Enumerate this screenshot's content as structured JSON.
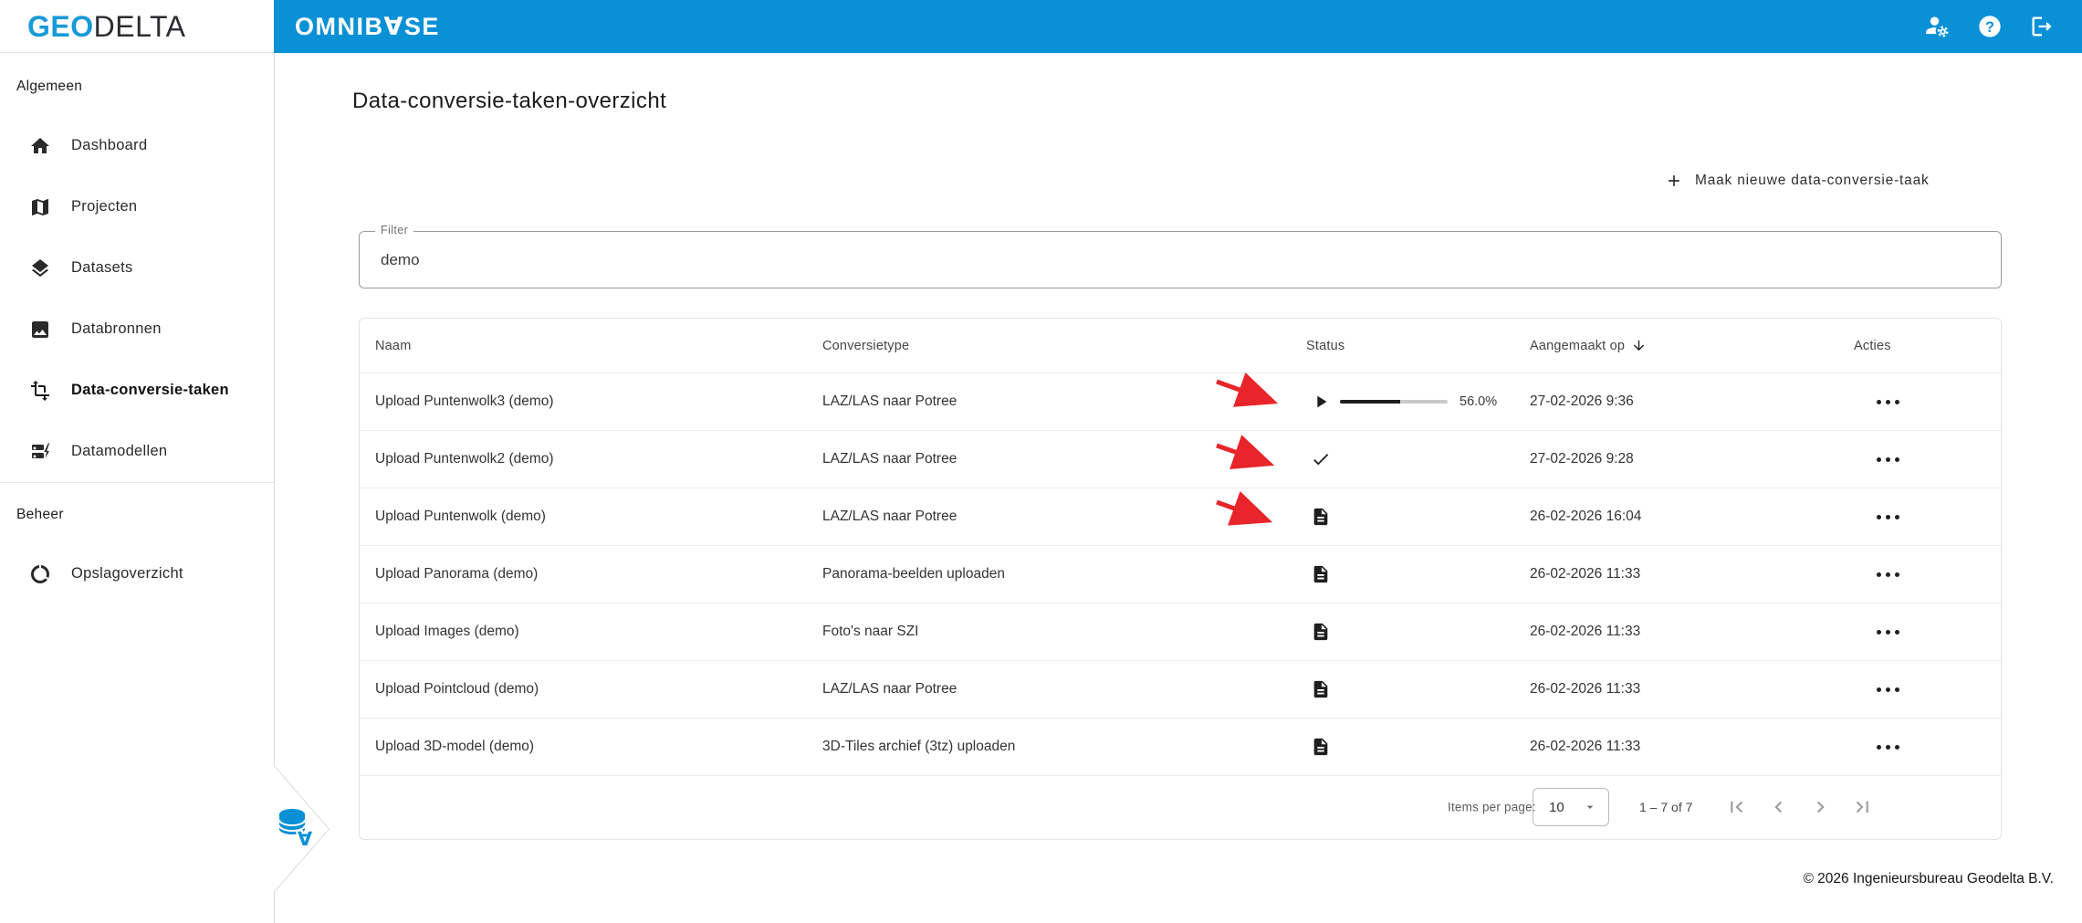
{
  "brand": {
    "logo_part1": "GEO",
    "logo_part2": "DELTA",
    "app_name": "OMNIB∀SE"
  },
  "colors": {
    "header_blue": "#0a90d5",
    "logo_blue": "#189ad8",
    "annotation_red": "#e8252a"
  },
  "sidebar": {
    "sections": [
      {
        "label": "Algemeen",
        "items": [
          {
            "label": "Dashboard",
            "icon": "home",
            "active": false
          },
          {
            "label": "Projecten",
            "icon": "map",
            "active": false
          },
          {
            "label": "Datasets",
            "icon": "layers",
            "active": false
          },
          {
            "label": "Databronnen",
            "icon": "image",
            "active": false
          },
          {
            "label": "Data-conversie-taken",
            "icon": "transform",
            "active": true
          },
          {
            "label": "Datamodellen",
            "icon": "data-model",
            "active": false
          }
        ]
      },
      {
        "label": "Beheer",
        "items": [
          {
            "label": "Opslagoverzicht",
            "icon": "storage-usage",
            "active": false
          }
        ]
      }
    ]
  },
  "main": {
    "page_title": "Data-conversie-taken-overzicht",
    "new_task_button": "Maak nieuwe data-conversie-taak",
    "filter": {
      "label": "Filter",
      "value": "demo"
    },
    "table": {
      "headers": {
        "name": "Naam",
        "type": "Conversietype",
        "status": "Status",
        "created": "Aangemaakt op",
        "actions": "Acties"
      },
      "sort": {
        "column": "Aangemaakt op",
        "direction": "desc"
      },
      "rows": [
        {
          "name": "Upload Puntenwolk3 (demo)",
          "type": "LAZ/LAS naar Potree",
          "status": "running",
          "progress_label": "56.0%",
          "progress_fraction": 0.56,
          "created": "27-02-2026 9:36"
        },
        {
          "name": "Upload Puntenwolk2 (demo)",
          "type": "LAZ/LAS naar Potree",
          "status": "completed",
          "created": "27-02-2026 9:28"
        },
        {
          "name": "Upload Puntenwolk (demo)",
          "type": "LAZ/LAS naar Potree",
          "status": "created",
          "created": "26-02-2026 16:04"
        },
        {
          "name": "Upload Panorama (demo)",
          "type": "Panorama-beelden uploaden",
          "status": "created",
          "created": "26-02-2026 11:33"
        },
        {
          "name": "Upload Images (demo)",
          "type": "Foto's naar SZI",
          "status": "created",
          "created": "26-02-2026 11:33"
        },
        {
          "name": "Upload Pointcloud (demo)",
          "type": "LAZ/LAS naar Potree",
          "status": "created",
          "created": "26-02-2026 11:33"
        },
        {
          "name": "Upload 3D-model (demo)",
          "type": "3D-Tiles archief (3tz) uploaden",
          "status": "created",
          "created": "26-02-2026 11:33"
        }
      ]
    },
    "pagination": {
      "items_per_page_label": "Items per page:",
      "items_per_page_value": "10",
      "range_label": "1 – 7 of 7"
    },
    "footer": "© 2026 Ingenieursbureau Geodelta B.V."
  }
}
